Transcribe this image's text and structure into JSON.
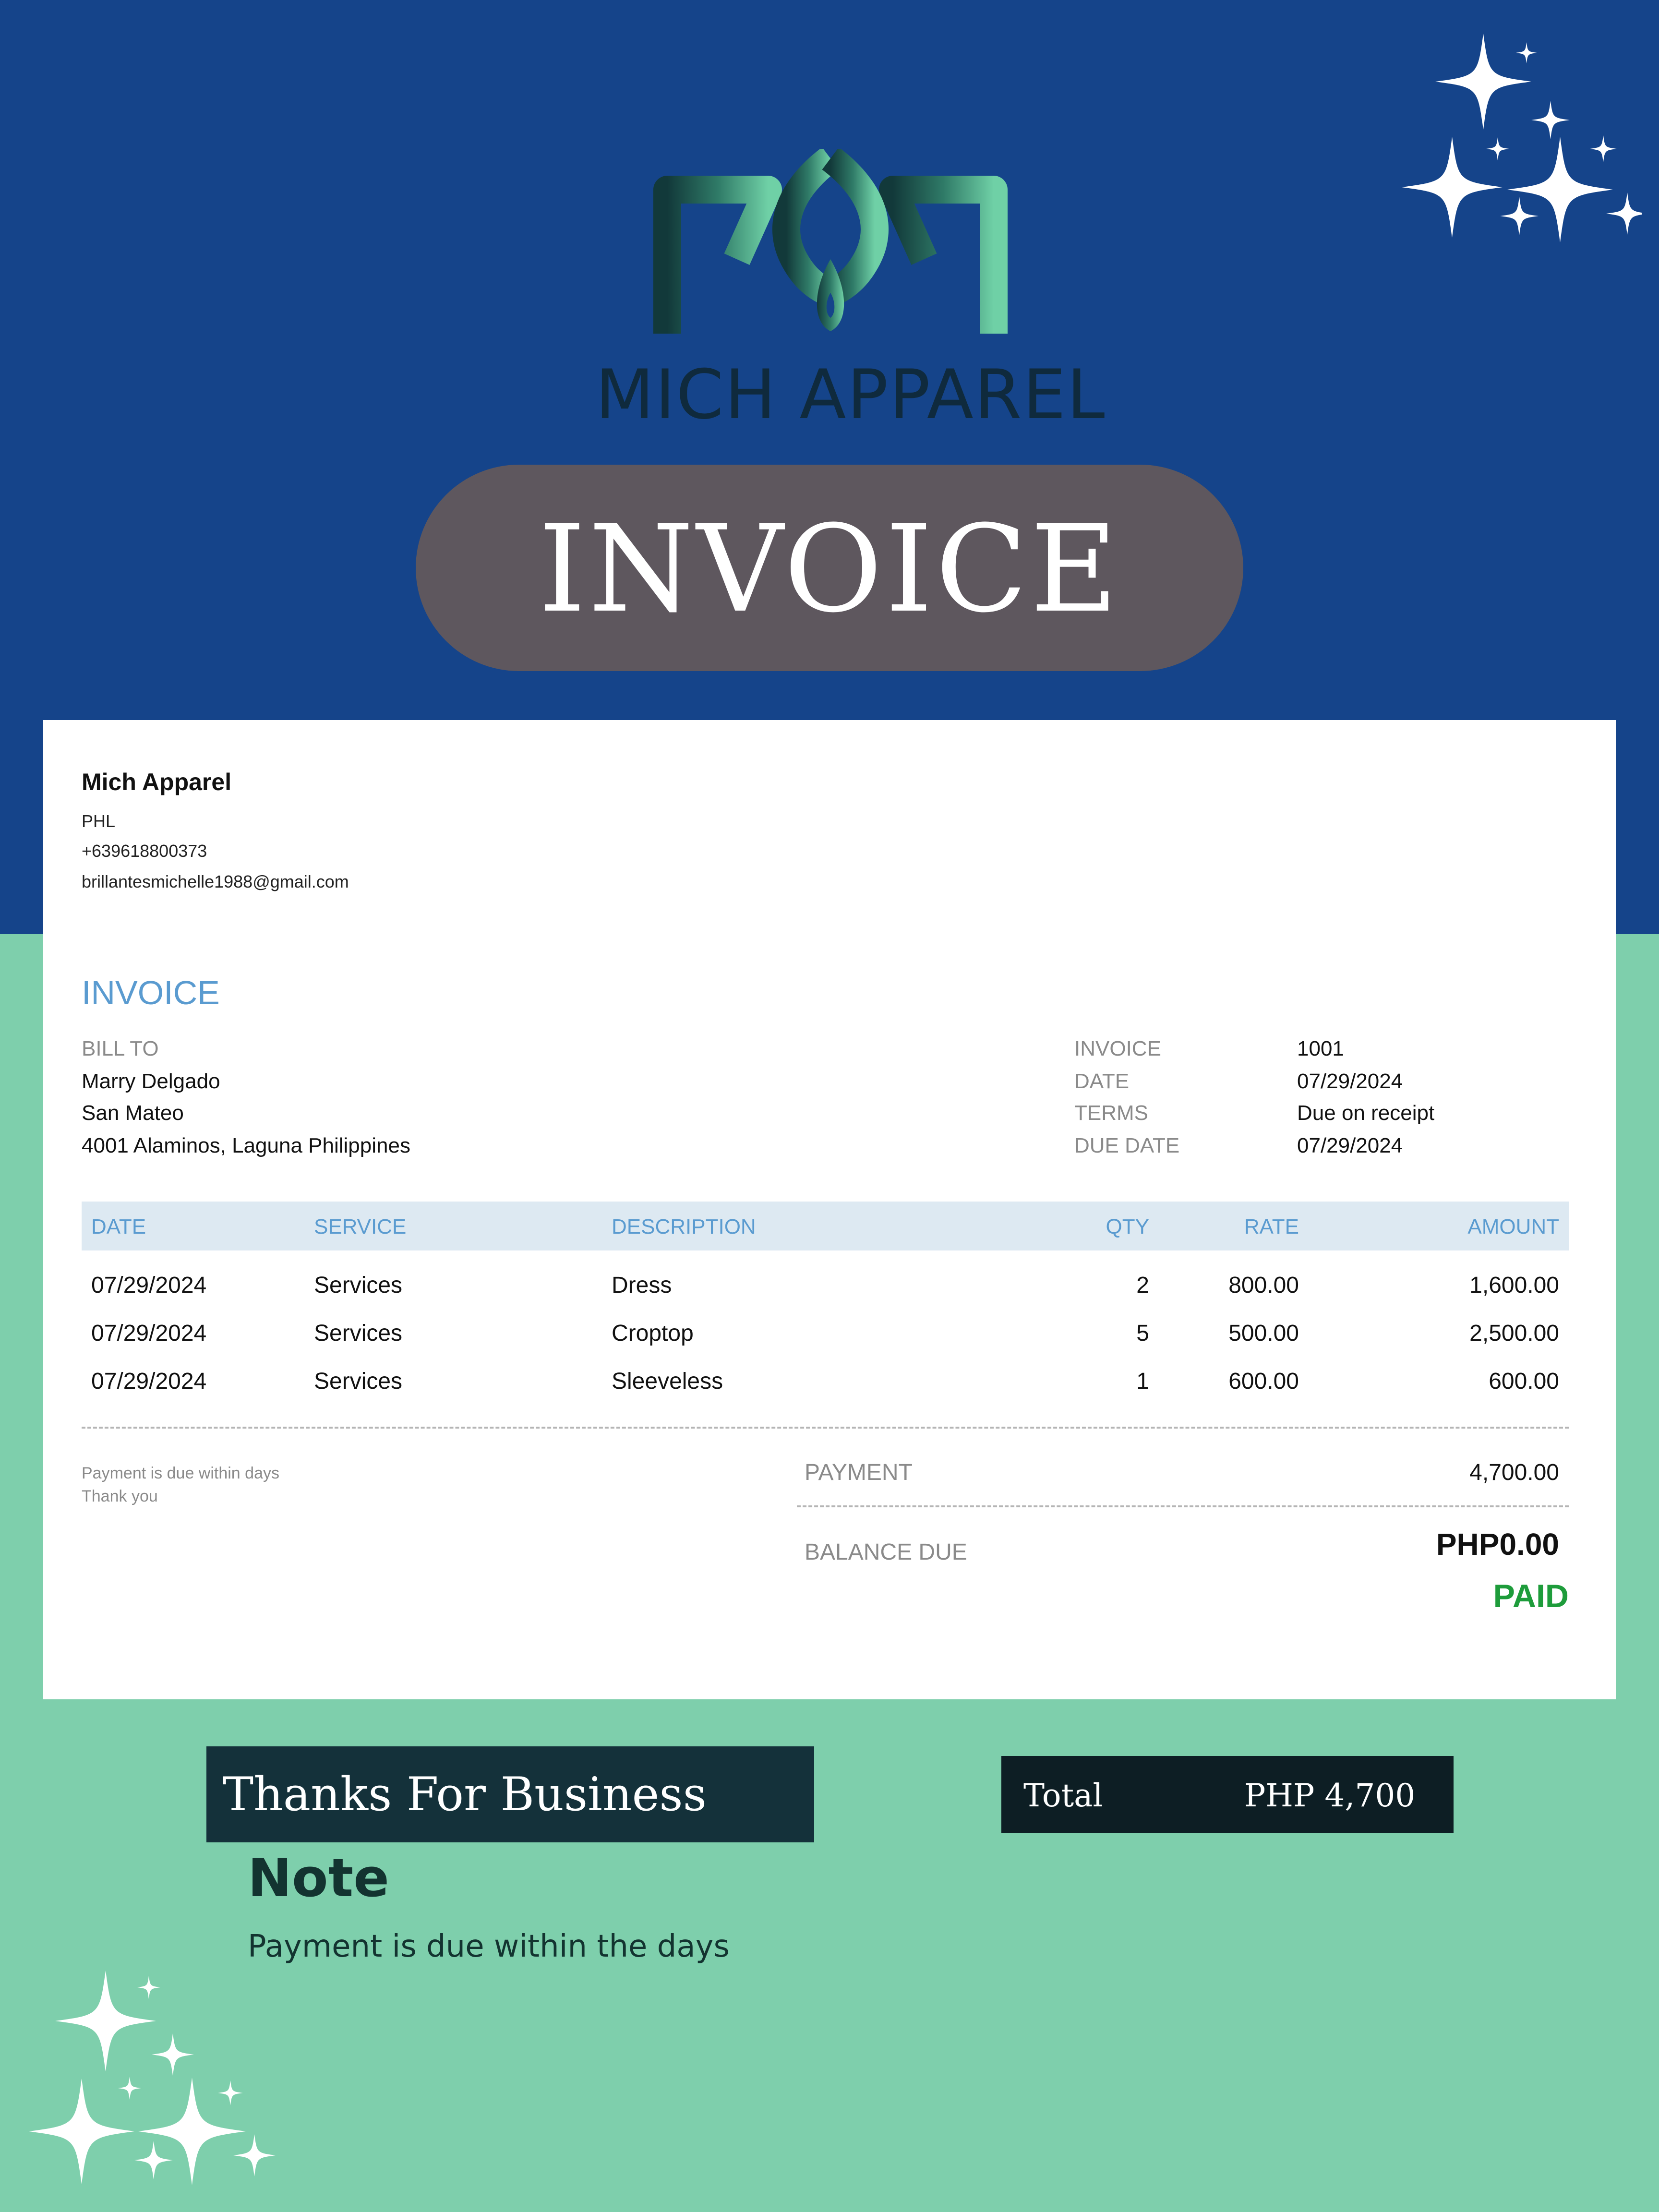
{
  "brand": {
    "name": "MICH APPAREL"
  },
  "banner": {
    "title": "INVOICE"
  },
  "company": {
    "name": "Mich Apparel",
    "country": "PHL",
    "phone": "+639618800373",
    "email": "brillantesmichelle1988@gmail.com"
  },
  "invoice": {
    "heading": "INVOICE",
    "bill_to_label": "BILL TO",
    "bill_to": [
      "Marry Delgado",
      "San Mateo",
      "4001 Alaminos, Laguna Philippines"
    ],
    "meta": [
      {
        "label": "INVOICE",
        "value": "1001"
      },
      {
        "label": "DATE",
        "value": "07/29/2024"
      },
      {
        "label": "TERMS",
        "value": "Due on receipt"
      },
      {
        "label": "DUE DATE",
        "value": "07/29/2024"
      }
    ]
  },
  "table": {
    "columns": [
      "DATE",
      "SERVICE",
      "DESCRIPTION",
      "QTY",
      "RATE",
      "AMOUNT"
    ],
    "rows": [
      [
        "07/29/2024",
        "Services",
        "Dress",
        "2",
        "800.00",
        "1,600.00"
      ],
      [
        "07/29/2024",
        "Services",
        "Croptop",
        "5",
        "500.00",
        "2,500.00"
      ],
      [
        "07/29/2024",
        "Services",
        "Sleeveless",
        "1",
        "600.00",
        "600.00"
      ]
    ]
  },
  "footer_note": [
    "Payment is due within days",
    "Thank you"
  ],
  "summary": {
    "payment_label": "PAYMENT",
    "payment_value": "4,700.00",
    "balance_label": "BALANCE DUE",
    "balance_value": "PHP0.00",
    "status": "PAID"
  },
  "thanks": "Thanks For Business",
  "total": {
    "label": "Total",
    "value": "PHP 4,700"
  },
  "note": {
    "title": "Note",
    "text": "Payment is due within the days"
  },
  "colors": {
    "top_background": "#15448a",
    "bottom_background": "#7ecfac",
    "pill": "#5e575e",
    "accent_blue": "#5a9bd0",
    "paid_green": "#1e9c3b",
    "dark_box": "#14313a"
  }
}
